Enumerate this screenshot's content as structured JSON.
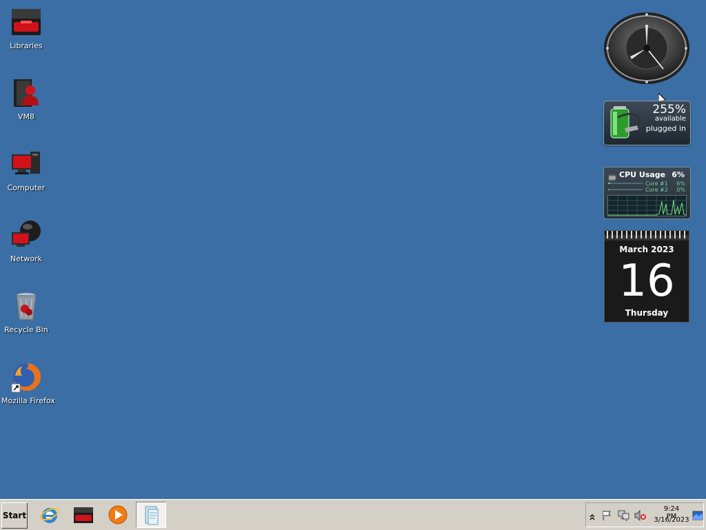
{
  "desktop": {
    "icons": [
      {
        "label": "Libraries"
      },
      {
        "label": "VM8"
      },
      {
        "label": "Computer"
      },
      {
        "label": "Network"
      },
      {
        "label": "Recycle Bin"
      },
      {
        "label": "Mozilla Firefox"
      }
    ]
  },
  "gadgets": {
    "battery": {
      "percent": "255%",
      "status1": "available",
      "status2": "plugged in"
    },
    "cpu": {
      "title": "CPU Usage",
      "total": "6%",
      "cores": [
        {
          "label": "Core #1",
          "value": "6%",
          "level": 0.06
        },
        {
          "label": "Core #2",
          "value": "0%",
          "level": 0.0
        }
      ]
    },
    "calendar": {
      "month_year": "March 2023",
      "day": "16",
      "weekday": "Thursday"
    }
  },
  "taskbar": {
    "start_label": "Start",
    "pinned": [
      {
        "name": "internet-explorer-icon"
      },
      {
        "name": "libraries-folder-icon"
      },
      {
        "name": "media-player-icon"
      },
      {
        "name": "document-window-icon"
      }
    ],
    "tray": {
      "time": "9:24 PM",
      "date": "3/16/2023"
    }
  },
  "colors": {
    "desktop": "#3a6ea5",
    "taskbar": "#d4d0c8",
    "accent_red": "#c8141c"
  }
}
